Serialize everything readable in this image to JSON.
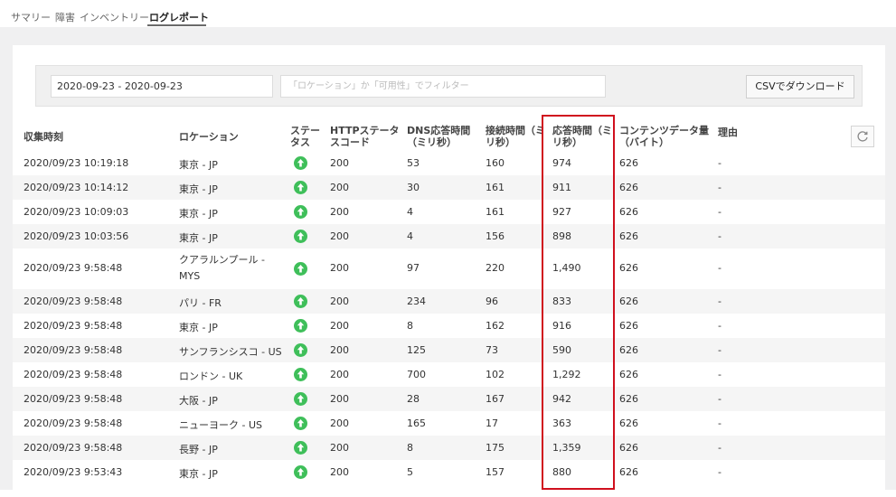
{
  "tabs": [
    {
      "label": "サマリー"
    },
    {
      "label": "障害"
    },
    {
      "label": "インベントリー"
    },
    {
      "label": "ログレポート"
    }
  ],
  "filters": {
    "date_range": "2020-09-23 - 2020-09-23",
    "filter_placeholder": "「ロケーション」か「可用性」でフィルター",
    "csv_button": "CSVでダウンロード"
  },
  "table": {
    "headers": {
      "collected": "収集時刻",
      "location": "ロケーション",
      "status": "ステータス",
      "http": "HTTPステータスコード",
      "dns": "DNS応答時間（ミリ秒）",
      "connect": "接続時間（ミリ秒）",
      "response": "応答時間（ミリ秒）",
      "content": "コンテンツデータ量（バイト）",
      "reason": "理由"
    },
    "rows": [
      {
        "time": "2020/09/23 10:19:18",
        "location": "東京 - JP",
        "http": "200",
        "dns": "53",
        "connect": "160",
        "response": "974",
        "content": "626",
        "reason": "-"
      },
      {
        "time": "2020/09/23 10:14:12",
        "location": "東京 - JP",
        "http": "200",
        "dns": "30",
        "connect": "161",
        "response": "911",
        "content": "626",
        "reason": "-"
      },
      {
        "time": "2020/09/23 10:09:03",
        "location": "東京 - JP",
        "http": "200",
        "dns": "4",
        "connect": "161",
        "response": "927",
        "content": "626",
        "reason": "-"
      },
      {
        "time": "2020/09/23 10:03:56",
        "location": "東京 - JP",
        "http": "200",
        "dns": "4",
        "connect": "156",
        "response": "898",
        "content": "626",
        "reason": "-"
      },
      {
        "time": "2020/09/23 9:58:48",
        "location": "クアラルンプール - MYS",
        "http": "200",
        "dns": "97",
        "connect": "220",
        "response": "1,490",
        "content": "626",
        "reason": "-"
      },
      {
        "time": "2020/09/23 9:58:48",
        "location": "パリ - FR",
        "http": "200",
        "dns": "234",
        "connect": "96",
        "response": "833",
        "content": "626",
        "reason": "-"
      },
      {
        "time": "2020/09/23 9:58:48",
        "location": "東京 - JP",
        "http": "200",
        "dns": "8",
        "connect": "162",
        "response": "916",
        "content": "626",
        "reason": "-"
      },
      {
        "time": "2020/09/23 9:58:48",
        "location": "サンフランシスコ - US",
        "http": "200",
        "dns": "125",
        "connect": "73",
        "response": "590",
        "content": "626",
        "reason": "-"
      },
      {
        "time": "2020/09/23 9:58:48",
        "location": "ロンドン - UK",
        "http": "200",
        "dns": "700",
        "connect": "102",
        "response": "1,292",
        "content": "626",
        "reason": "-"
      },
      {
        "time": "2020/09/23 9:58:48",
        "location": "大阪 - JP",
        "http": "200",
        "dns": "28",
        "connect": "167",
        "response": "942",
        "content": "626",
        "reason": "-"
      },
      {
        "time": "2020/09/23 9:58:48",
        "location": "ニューヨーク - US",
        "http": "200",
        "dns": "165",
        "connect": "17",
        "response": "363",
        "content": "626",
        "reason": "-"
      },
      {
        "time": "2020/09/23 9:58:48",
        "location": "長野 - JP",
        "http": "200",
        "dns": "8",
        "connect": "175",
        "response": "1,359",
        "content": "626",
        "reason": "-"
      },
      {
        "time": "2020/09/23 9:53:43",
        "location": "東京 - JP",
        "http": "200",
        "dns": "5",
        "connect": "157",
        "response": "880",
        "content": "626",
        "reason": "-"
      }
    ]
  },
  "colors": {
    "status_up": "#3fbf5a",
    "highlight": "#d0101e"
  },
  "icons": {
    "status": "arrow-up-circle-icon",
    "refresh": "refresh-icon"
  }
}
